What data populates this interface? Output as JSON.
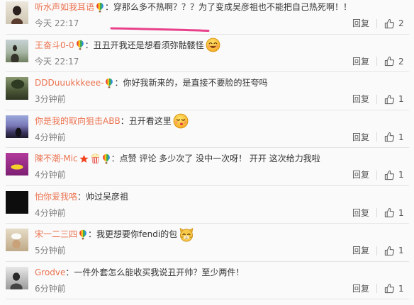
{
  "reply_label": "回复",
  "colors": {
    "username": "#eb7350",
    "comment_text": "#333333",
    "meta_text": "#808080",
    "underline": "#e8408a",
    "divider": "#e4e4e4"
  },
  "comments": [
    {
      "user": "听水声如我耳语",
      "badges": [
        "balloon-icon"
      ],
      "text": "：穿那么多不热啊？？？为了变成吴彦祖也不能把自己热死啊！！",
      "emoji": null,
      "time": "今天 22:17",
      "likes": 2
    },
    {
      "user": "王奋斗0-0",
      "badges": [
        "balloon-icon"
      ],
      "text": "：丑丑开我还是想看须弥骷髅怪",
      "emoji": "grin-emoji",
      "time": "今天 22:17",
      "likes": 2
    },
    {
      "user": "DDDuuukkkeee-",
      "badges": [
        "balloon-icon"
      ],
      "text": "：你好我新来的，是直接不要脸的狂夸吗",
      "emoji": null,
      "time": "3分钟前",
      "likes": 1
    },
    {
      "user": "你是我的取向狙击ABB",
      "badges": [],
      "text": "：丑开看这里",
      "emoji": "kiss-emoji",
      "time": "4分钟前",
      "likes": 1
    },
    {
      "user": "陳不潮-Mic",
      "badges": [
        "star-icon",
        "popcorn-icon",
        "balloon-icon"
      ],
      "text": "：点赞 评论 多少次了 没中一次呀！ 开开 这次给力我啦",
      "emoji": null,
      "time": "4分钟前",
      "likes": 1
    },
    {
      "user": "怕你爱我咯",
      "badges": [],
      "text": "：帅过吴彦祖",
      "emoji": null,
      "time": "4分钟前",
      "likes": 1
    },
    {
      "user": "宋一二三四",
      "badges": [
        "balloon-icon"
      ],
      "text": "：我更想要你fendi的包",
      "emoji": "cat-emoji",
      "time": "5分钟前",
      "likes": 1
    },
    {
      "user": "Grodve",
      "badges": [],
      "text": "：一件外套怎么能收买我说丑开帅？至少两件！",
      "emoji": null,
      "time": "6分钟前",
      "likes": 1
    }
  ]
}
